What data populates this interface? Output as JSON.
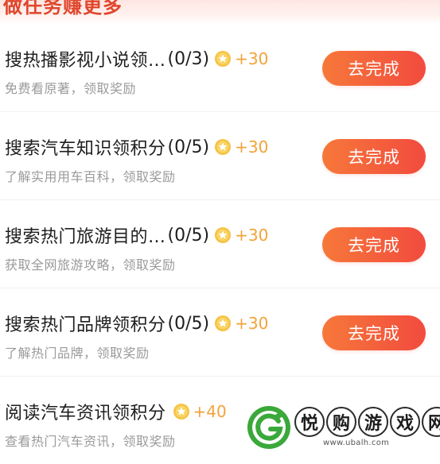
{
  "section": {
    "title": "做任务赚更多"
  },
  "colors": {
    "accent": "#f24b3e",
    "reward": "#f2a33a",
    "button_start": "#f6783a"
  },
  "tasks": [
    {
      "title": "搜热播影视小说领…",
      "count": "(0/3)",
      "reward": "+30",
      "desc": "免费看原著，领取奖励",
      "button": "去完成",
      "icon": "coin-icon"
    },
    {
      "title": "搜索汽车知识领积分",
      "count": "(0/5)",
      "reward": "+30",
      "desc": "了解实用用车百科，领取奖励",
      "button": "去完成",
      "icon": "coin-icon"
    },
    {
      "title": "搜索热门旅游目的…",
      "count": "(0/5)",
      "reward": "+30",
      "desc": "获取全网旅游攻略，领取奖励",
      "button": "去完成",
      "icon": "coin-icon"
    },
    {
      "title": "搜索热门品牌领积分",
      "count": "(0/5)",
      "reward": "+30",
      "desc": "了解热门品牌，领取奖励",
      "button": "去完成",
      "icon": "coin-icon"
    },
    {
      "title": "阅读汽车资讯领积分",
      "count": "",
      "reward": "+40",
      "desc": "查看热门汽车资讯，领取奖励",
      "icon": "coin-icon"
    }
  ],
  "watermark": {
    "chars": [
      "悦",
      "购",
      "游",
      "戏",
      "网"
    ],
    "url": "www.ubalh.com",
    "icon": "logo-icon"
  }
}
